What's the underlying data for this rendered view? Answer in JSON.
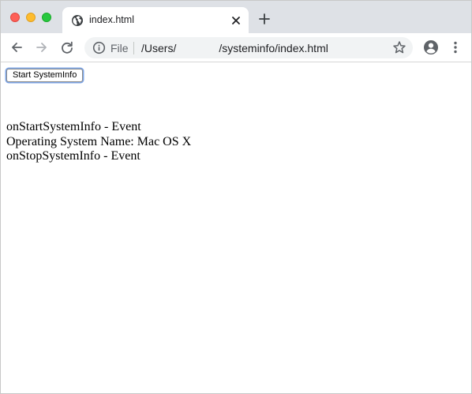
{
  "browser": {
    "tab": {
      "title": "index.html"
    },
    "address_bar": {
      "scheme_label": "File",
      "url_prefix": "/Users/",
      "url_redacted": "",
      "url_suffix": "/systeminfo/index.html"
    },
    "icons": {
      "back": "back-arrow-icon",
      "forward": "forward-arrow-icon",
      "reload": "reload-icon",
      "info": "info-icon",
      "bookmark": "star-icon",
      "profile": "profile-icon",
      "menu": "menu-icon",
      "new_tab": "plus-icon",
      "close_tab": "close-icon",
      "site": "globe-icon"
    },
    "colors": {
      "close_light": "#fe5f57",
      "minimize_light": "#febc2e",
      "zoom_light": "#28c840",
      "tabstrip": "#dee1e6",
      "omnibox": "#f1f3f4",
      "button_focus": "#7fa7e8"
    }
  },
  "page": {
    "start_button_label": "Start SystemInfo",
    "log_lines": [
      "onStartSystemInfo - Event",
      "Operating System Name: Mac OS X",
      "onStopSystemInfo - Event"
    ]
  }
}
